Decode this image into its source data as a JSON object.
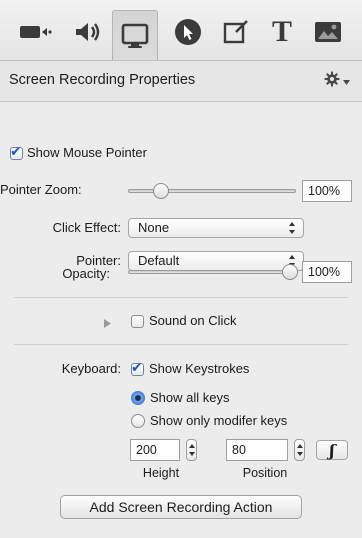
{
  "toolbar": {
    "tabs": [
      {
        "name": "video-camera-icon"
      },
      {
        "name": "speaker-icon"
      },
      {
        "name": "screen-icon",
        "active": true
      },
      {
        "name": "cursor-icon"
      },
      {
        "name": "annotation-icon"
      },
      {
        "name": "text-icon",
        "glyph": "T"
      },
      {
        "name": "image-icon"
      }
    ]
  },
  "panel": {
    "title": "Screen Recording Properties",
    "gear_icon": "gear-icon"
  },
  "show_mouse_pointer": {
    "label": "Show Mouse Pointer",
    "checked": true
  },
  "pointer_zoom": {
    "label": "Pointer Zoom:",
    "value": "100%",
    "slider_fraction": 0.17
  },
  "click_effect": {
    "label": "Click Effect:",
    "value": "None"
  },
  "pointer": {
    "label": "Pointer:",
    "value": "Default"
  },
  "opacity": {
    "label": "Opacity:",
    "value": "100%",
    "slider_fraction": 1.0
  },
  "sound_on_click": {
    "label": "Sound on Click",
    "checked": false
  },
  "keyboard": {
    "label": "Keyboard:",
    "show_keystrokes": {
      "label": "Show Keystrokes",
      "checked": true
    },
    "options": [
      {
        "label": "Show all keys",
        "selected": true
      },
      {
        "label": "Show only modifer keys",
        "selected": false
      }
    ],
    "height_value": "200",
    "height_label": "Height",
    "position_value": "80",
    "position_label": "Position",
    "script_button_glyph": "ʃ"
  },
  "add_action_button": "Add Screen Recording Action",
  "colors": {
    "accent": "#1f58c8",
    "panel_bg": "#ececec"
  }
}
